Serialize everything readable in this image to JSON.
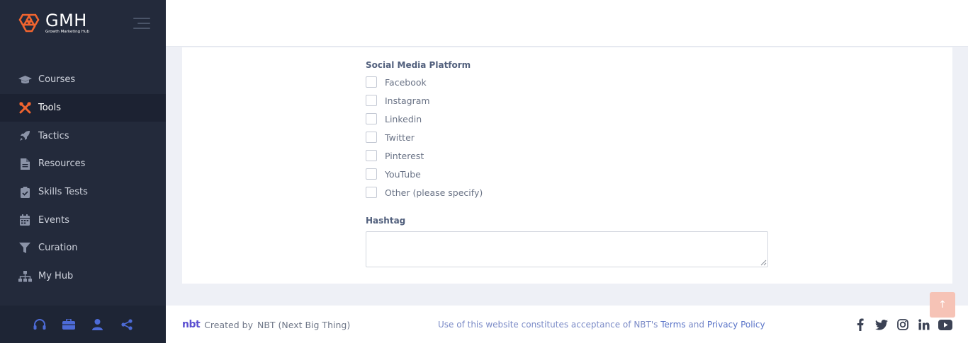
{
  "brand": {
    "title": "GMH",
    "subtitle": "Growth Marketing Hub"
  },
  "sidebar": {
    "items": [
      {
        "label": "Courses",
        "icon": "graduation-cap-icon"
      },
      {
        "label": "Tools",
        "icon": "tools-icon",
        "active": true
      },
      {
        "label": "Tactics",
        "icon": "rocket-icon"
      },
      {
        "label": "Resources",
        "icon": "file-icon"
      },
      {
        "label": "Skills Tests",
        "icon": "clipboard-check-icon"
      },
      {
        "label": "Events",
        "icon": "calendar-icon"
      },
      {
        "label": "Curation",
        "icon": "filter-icon"
      },
      {
        "label": "My Hub",
        "icon": "sitemap-icon"
      }
    ],
    "footer_icons": [
      "headset-icon",
      "briefcase-icon",
      "user-icon",
      "share-icon"
    ]
  },
  "form": {
    "platform_label": "Social Media Platform",
    "platforms": [
      {
        "label": "Facebook",
        "checked": false
      },
      {
        "label": "Instagram",
        "checked": false
      },
      {
        "label": "Linkedin",
        "checked": false
      },
      {
        "label": "Twitter",
        "checked": false
      },
      {
        "label": "Pinterest",
        "checked": false
      },
      {
        "label": "YouTube",
        "checked": false
      },
      {
        "label": "Other (please specify)",
        "checked": false
      }
    ],
    "hashtag_label": "Hashtag",
    "hashtag_value": ""
  },
  "footer": {
    "logo_text": "nbt",
    "created_by": "Created by",
    "company": "NBT (Next Big Thing)",
    "terms_prefix": "Use of this website constitutes acceptance of NBT's",
    "terms_link": "Terms",
    "terms_and": "and",
    "privacy_link": "Privacy Policy",
    "social": [
      "facebook-icon",
      "twitter-icon",
      "instagram-icon",
      "linkedin-icon",
      "youtube-icon"
    ]
  },
  "back_to_top": "↑",
  "colors": {
    "accent": "#f0642f",
    "sidebar": "#232a3b",
    "link": "#5a74c8",
    "back_to_top": "#f6c3b6"
  }
}
